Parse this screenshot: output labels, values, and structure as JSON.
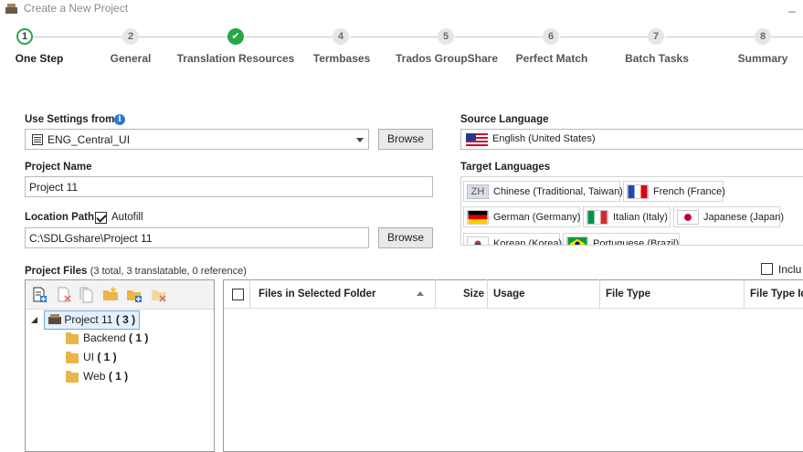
{
  "window": {
    "title": "Create a New Project",
    "minimize_glyph": "_"
  },
  "steps": [
    {
      "number": "1",
      "label": "One Step",
      "state": "current"
    },
    {
      "number": "2",
      "label": "General",
      "state": "pending"
    },
    {
      "number": "✔",
      "label": "Translation Resources",
      "state": "done"
    },
    {
      "number": "4",
      "label": "Termbases",
      "state": "pending"
    },
    {
      "number": "5",
      "label": "Trados GroupShare",
      "state": "pending"
    },
    {
      "number": "6",
      "label": "Perfect Match",
      "state": "pending"
    },
    {
      "number": "7",
      "label": "Batch Tasks",
      "state": "pending"
    },
    {
      "number": "8",
      "label": "Summary",
      "state": "pending"
    }
  ],
  "settings": {
    "use_settings_label": "Use Settings from",
    "use_settings_value": "ENG_Central_UI",
    "browse_label": "Browse",
    "info_glyph": "i"
  },
  "project": {
    "name_label": "Project Name",
    "name_value": "Project 11",
    "location_label": "Location Path",
    "autofill_label": "Autofill",
    "autofill_checked": true,
    "location_value": "C:\\SDLGshare\\Project 11",
    "browse_label": "Browse"
  },
  "languages": {
    "source_label": "Source Language",
    "source_value": "English (United States)",
    "target_label": "Target Languages",
    "targets": [
      {
        "name": "Chinese (Traditional, Taiwan)",
        "flag": "zh-text",
        "flag_text": "ZH"
      },
      {
        "name": "French (France)",
        "flag": "fr"
      },
      {
        "name": "German (Germany)",
        "flag": "de"
      },
      {
        "name": "Italian (Italy)",
        "flag": "it"
      },
      {
        "name": "Japanese (Japan)",
        "flag": "jp"
      },
      {
        "name": "Korean (Korea)",
        "flag": "kr"
      },
      {
        "name": "Portuguese (Brazil)",
        "flag": "br"
      }
    ]
  },
  "files": {
    "label": "Project Files",
    "summary": "(3 total, 3 translatable, 0 reference)",
    "include_label": "Inclu",
    "tree": {
      "root": {
        "name": "Project 11",
        "count": "( 3 )"
      },
      "children": [
        {
          "name": "Backend",
          "count": "( 1 )"
        },
        {
          "name": "UI",
          "count": "( 1 )"
        },
        {
          "name": "Web",
          "count": "( 1 )"
        }
      ]
    },
    "columns": {
      "files": "Files in Selected Folder",
      "size": "Size",
      "usage": "Usage",
      "file_type": "File Type",
      "file_type_id": "File Type Id"
    }
  },
  "colors": {
    "accent_green": "#28a745",
    "info_blue": "#2b78d0",
    "folder": "#e8b64a"
  }
}
